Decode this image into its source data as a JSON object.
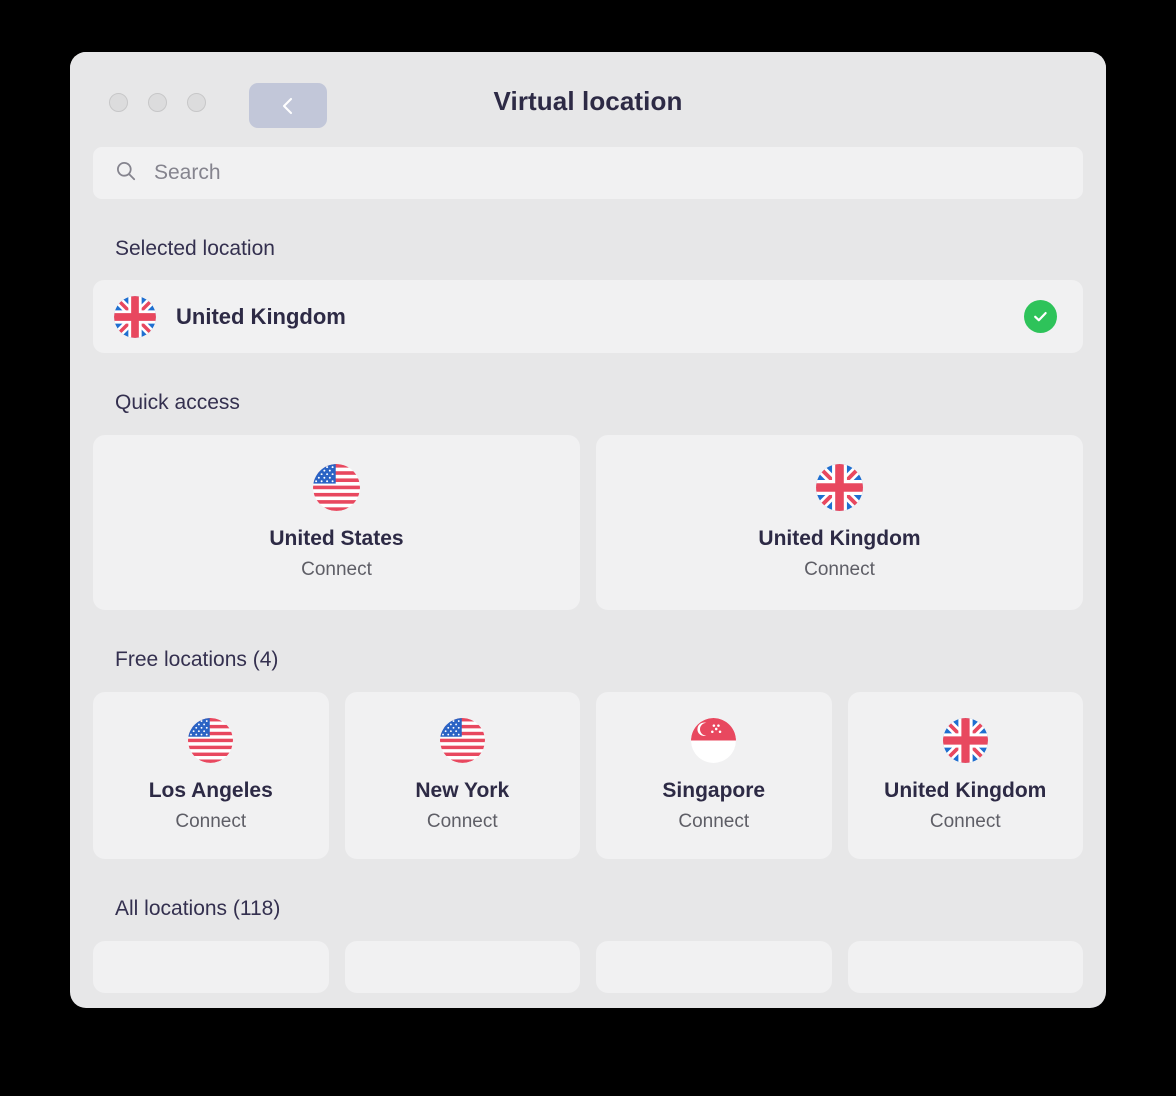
{
  "window": {
    "title": "Virtual location",
    "traffic_lights": [
      "close",
      "minimize",
      "zoom"
    ],
    "back_label": "Back"
  },
  "search": {
    "placeholder": "Search",
    "value": "",
    "icon": "search-icon"
  },
  "sections": {
    "selected": {
      "title": "Selected location",
      "item": {
        "name": "United Kingdom",
        "flag": "gb",
        "status_icon": "check-circle-icon",
        "selected": true
      }
    },
    "quick_access": {
      "title": "Quick access",
      "items": [
        {
          "name": "United States",
          "action": "Connect",
          "flag": "us"
        },
        {
          "name": "United Kingdom",
          "action": "Connect",
          "flag": "gb"
        }
      ]
    },
    "free_locations": {
      "title": "Free locations (4)",
      "count": 4,
      "items": [
        {
          "name": "Los Angeles",
          "action": "Connect",
          "flag": "us"
        },
        {
          "name": "New York",
          "action": "Connect",
          "flag": "us"
        },
        {
          "name": "Singapore",
          "action": "Connect",
          "flag": "sg"
        },
        {
          "name": "United Kingdom",
          "action": "Connect",
          "flag": "gb"
        }
      ]
    },
    "all_locations": {
      "title": "All locations (118)",
      "count": 118,
      "items": [
        {
          "name": "",
          "action": "",
          "flag": "none"
        },
        {
          "name": "",
          "action": "",
          "flag": "none"
        },
        {
          "name": "",
          "action": "",
          "flag": "none"
        },
        {
          "name": "",
          "action": "",
          "flag": "none"
        }
      ]
    }
  },
  "colors": {
    "window_bg": "#e7e7e8",
    "card_bg": "#f1f1f2",
    "title_text": "#2d2a45",
    "muted_text": "#5e5e66",
    "placeholder_text": "#85848e",
    "back_button_bg": "#c2c7d9",
    "check_green": "#2ec35a"
  }
}
